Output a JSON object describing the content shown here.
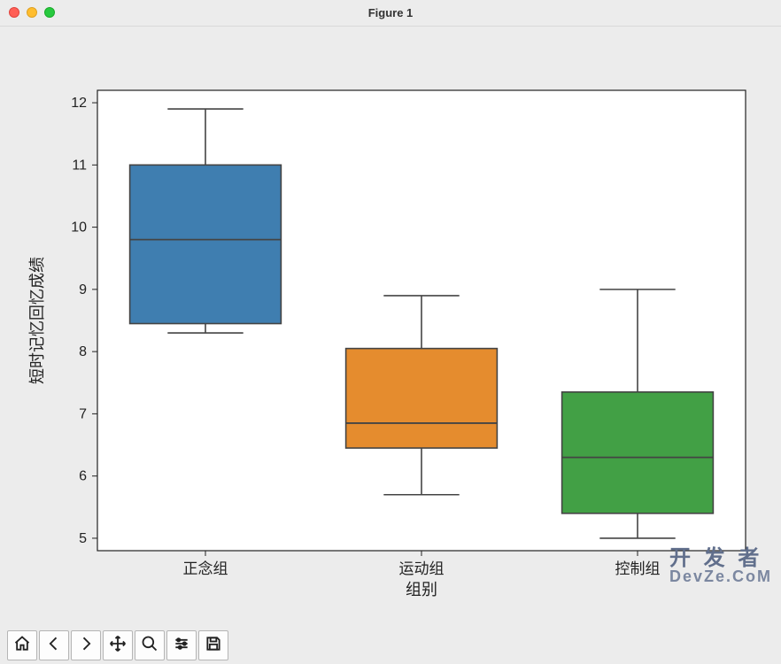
{
  "window": {
    "title": "Figure 1"
  },
  "chart_data": {
    "type": "boxplot",
    "categories": [
      "正念组",
      "运动组",
      "控制组"
    ],
    "series": [
      {
        "name": "正念组",
        "min": 8.3,
        "q1": 8.45,
        "median": 9.8,
        "q3": 11.0,
        "max": 11.9,
        "color": "#3f7eb0"
      },
      {
        "name": "运动组",
        "min": 5.7,
        "q1": 6.45,
        "median": 6.85,
        "q3": 8.05,
        "max": 8.9,
        "color": "#e58c2e"
      },
      {
        "name": "控制组",
        "min": 5.0,
        "q1": 5.4,
        "median": 6.3,
        "q3": 7.35,
        "max": 9.0,
        "color": "#42a045"
      }
    ],
    "xlabel": "组别",
    "ylabel": "短时记忆回忆成绩",
    "yticks": [
      5,
      6,
      7,
      8,
      9,
      10,
      11,
      12
    ],
    "ylim": [
      4.8,
      12.2
    ]
  },
  "toolbar": {
    "home": "Home",
    "back": "Back",
    "forward": "Forward",
    "pan": "Pan",
    "zoom": "Zoom",
    "adjust": "Configure",
    "save": "Save"
  },
  "watermark": {
    "line1": "开 发 者",
    "line2": "DevZe.CoM"
  }
}
